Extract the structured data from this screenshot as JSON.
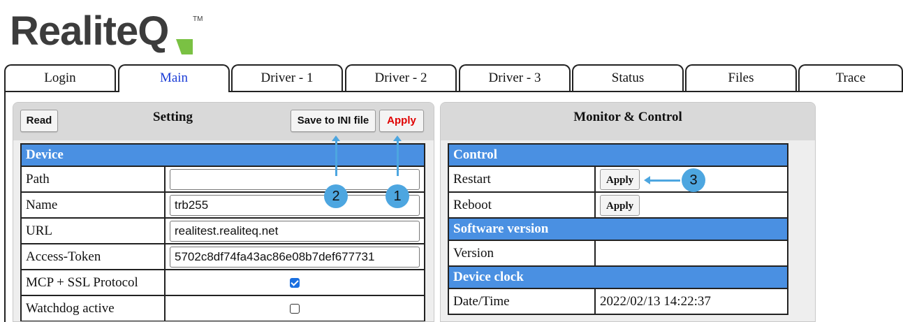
{
  "logo": {
    "text": "RealiteQ",
    "tm": "TM"
  },
  "tabs": [
    "Login",
    "Main",
    "Driver - 1",
    "Driver - 2",
    "Driver - 3",
    "Status",
    "Files",
    "Trace"
  ],
  "setting": {
    "title": "Setting",
    "read_label": "Read",
    "save_label": "Save to INI file",
    "apply_label": "Apply",
    "section_device": "Device",
    "rows": [
      {
        "label": "Path",
        "value": ""
      },
      {
        "label": "Name",
        "value": "trb255"
      },
      {
        "label": "URL",
        "value": "realitest.realiteq.net"
      },
      {
        "label": "Access-Token",
        "value": "5702c8df74fa43ac86e08b7def677731"
      }
    ],
    "ssl_label": "MCP + SSL Protocol",
    "watchdog_label": "Watchdog active"
  },
  "monitor": {
    "title": "Monitor & Control",
    "section_control": "Control",
    "restart_label": "Restart",
    "reboot_label": "Reboot",
    "apply_label": "Apply",
    "section_software": "Software version",
    "version_label": "Version",
    "version_value": "",
    "section_clock": "Device clock",
    "datetime_label": "Date/Time",
    "datetime_value": "2022/02/13 14:22:37"
  },
  "callouts": [
    "1",
    "2",
    "3"
  ],
  "colors": {
    "accent": "#4a90e2",
    "callout": "#4da6e0",
    "logo_green": "#7ac143",
    "logo_dark": "#3c3c3c"
  }
}
